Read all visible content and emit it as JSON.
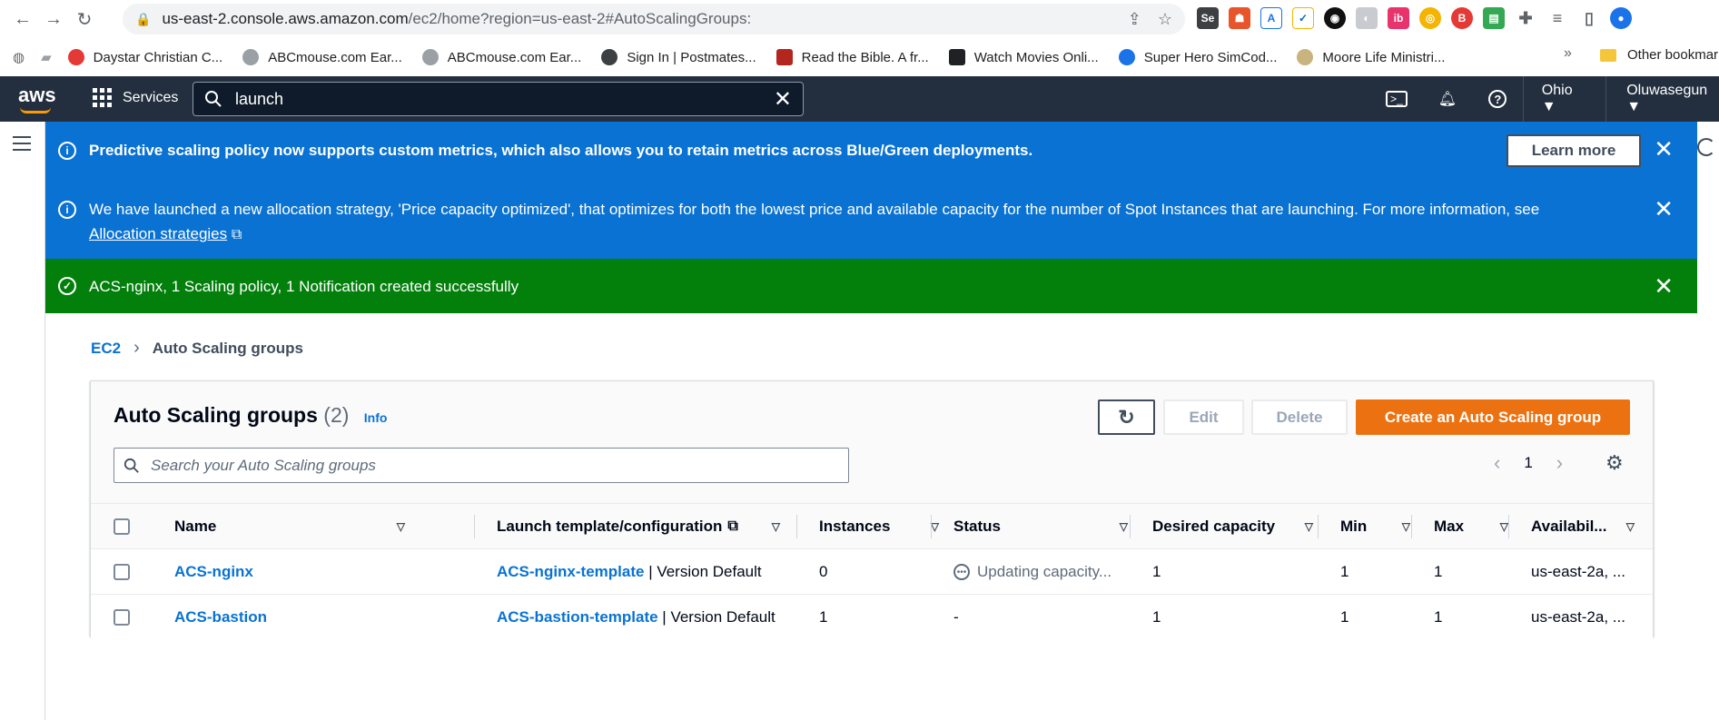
{
  "browser": {
    "url_main": "us-east-2.console.aws.amazon.com",
    "url_rest": "/ec2/home?region=us-east-2#AutoScalingGroups:",
    "bookmarks": [
      "Daystar Christian C...",
      "ABCmouse.com Ear...",
      "ABCmouse.com Ear...",
      "Sign In | Postmates...",
      "Read the Bible. A fr...",
      "Watch Movies Onli...",
      "Super Hero SimCod...",
      "Moore Life Ministri..."
    ],
    "bookmarks_more": "»",
    "other_bookmarks": "Other bookmar"
  },
  "aws": {
    "logo": "aws",
    "services": "Services",
    "search_value": "launch",
    "region": "Ohio ▼",
    "user": "Oluwasegun ▼"
  },
  "flash": {
    "predictive": "Predictive scaling policy now supports custom metrics, which also allows you to retain metrics across Blue/Green deployments.",
    "learn_more": "Learn more",
    "allocation": "We have launched a new allocation strategy, 'Price capacity optimized', that optimizes for both the lowest price and available capacity for the number of Spot Instances that are launching. For more information, see",
    "allocation_link": "Allocation strategies",
    "success": "ACS-nginx, 1 Scaling policy, 1 Notification created successfully"
  },
  "breadcrumb": {
    "root": "EC2",
    "current": "Auto Scaling groups"
  },
  "panel": {
    "title": "Auto Scaling groups",
    "count": "(2)",
    "info": "Info",
    "edit": "Edit",
    "delete": "Delete",
    "create": "Create an Auto Scaling group",
    "search_placeholder": "Search your Auto Scaling groups",
    "page": "1"
  },
  "columns": [
    "Name",
    "Launch template/configuration",
    "Instances",
    "Status",
    "Desired capacity",
    "Min",
    "Max",
    "Availabil..."
  ],
  "rows": [
    {
      "name": "ACS-nginx",
      "template": "ACS-nginx-template",
      "version": " | Version Default",
      "instances": "0",
      "status": "Updating capacity...",
      "desired": "1",
      "min": "1",
      "max": "1",
      "az": "us-east-2a, ..."
    },
    {
      "name": "ACS-bastion",
      "template": "ACS-bastion-template",
      "version": " | Version Default",
      "instances": "1",
      "status": "-",
      "desired": "1",
      "min": "1",
      "max": "1",
      "az": "us-east-2a, ..."
    }
  ]
}
